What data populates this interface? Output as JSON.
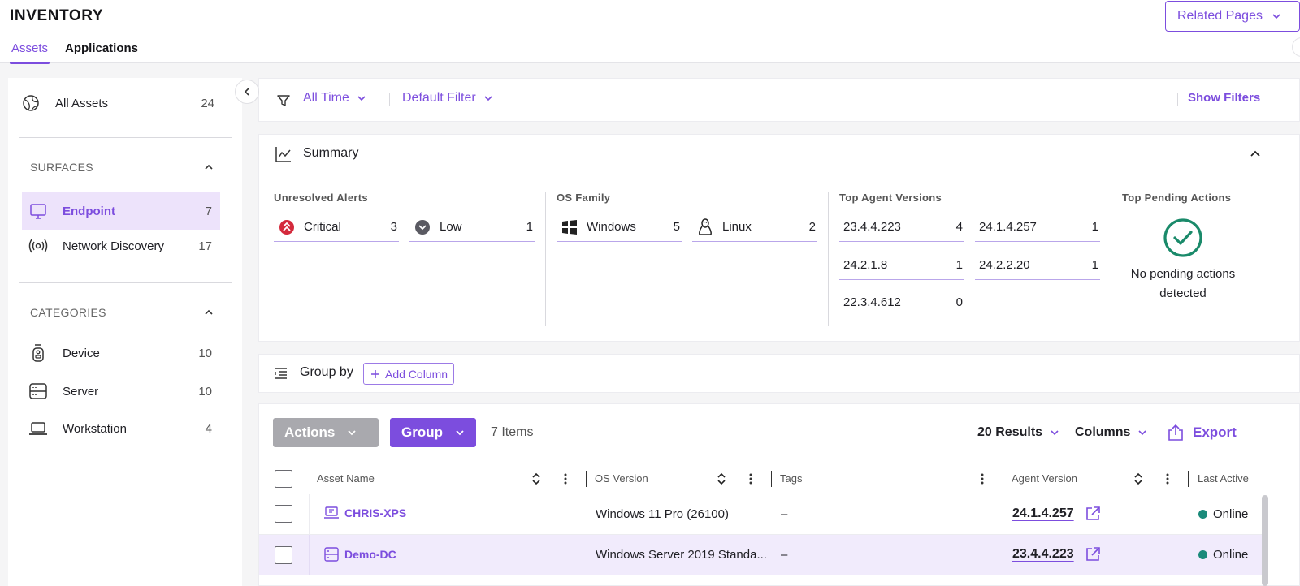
{
  "header": {
    "title": "INVENTORY",
    "related_pages": "Related Pages",
    "tabs": [
      "Assets",
      "Applications"
    ]
  },
  "sidebar": {
    "all_assets": {
      "label": "All Assets",
      "count": "24"
    },
    "surfaces_title": "SURFACES",
    "surfaces": [
      {
        "label": "Endpoint",
        "count": "7",
        "icon": "monitor-icon"
      },
      {
        "label": "Network Discovery",
        "count": "17",
        "icon": "broadcast-icon"
      }
    ],
    "categories_title": "CATEGORIES",
    "categories": [
      {
        "label": "Device",
        "count": "10",
        "icon": "device-icon"
      },
      {
        "label": "Server",
        "count": "10",
        "icon": "server-icon"
      },
      {
        "label": "Workstation",
        "count": "4",
        "icon": "laptop-icon"
      }
    ]
  },
  "filters": {
    "time": "All Time",
    "filter": "Default Filter",
    "show_filters": "Show Filters"
  },
  "summary": {
    "title": "Summary",
    "alerts_title": "Unresolved Alerts",
    "alerts": [
      {
        "label": "Critical",
        "count": "3"
      },
      {
        "label": "Low",
        "count": "1"
      }
    ],
    "os_title": "OS Family",
    "os": [
      {
        "label": "Windows",
        "count": "5"
      },
      {
        "label": "Linux",
        "count": "2"
      }
    ],
    "agent_title": "Top Agent Versions",
    "agents": [
      {
        "label": "23.4.4.223",
        "count": "4"
      },
      {
        "label": "24.1.4.257",
        "count": "1"
      },
      {
        "label": "24.2.1.8",
        "count": "1"
      },
      {
        "label": "24.2.2.20",
        "count": "1"
      },
      {
        "label": "22.3.4.612",
        "count": "0"
      }
    ],
    "pending_title": "Top Pending Actions",
    "pending_line1": "No pending actions",
    "pending_line2": "detected"
  },
  "groupbar": {
    "label": "Group by",
    "add_column": "Add Column"
  },
  "table": {
    "actions": "Actions",
    "group": "Group",
    "items": "7 Items",
    "results": "20 Results",
    "columns": "Columns",
    "export": "Export",
    "headers": [
      "Asset Name",
      "OS Version",
      "Tags",
      "Agent Version",
      "Last Active"
    ],
    "rows": [
      {
        "name": "CHRIS-XPS",
        "os": "Windows 11 Pro (26100)",
        "tags": "–",
        "agent": "24.1.4.257",
        "status": "Online"
      },
      {
        "name": "Demo-DC",
        "os": "Windows Server 2019 Standa...",
        "tags": "–",
        "agent": "23.4.4.223",
        "status": "Online"
      }
    ]
  },
  "colors": {
    "accent": "#7c4dde",
    "online": "#1a8a7a",
    "critical": "#d42a3c",
    "success": "#1a8a6a"
  }
}
